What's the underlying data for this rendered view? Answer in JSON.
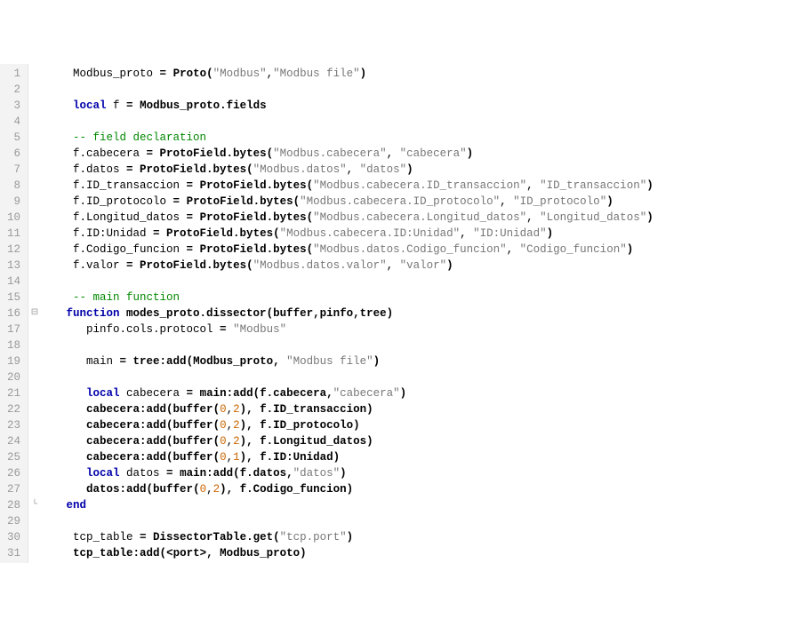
{
  "fold_marks": {
    "16": "⊟",
    "28": "└"
  },
  "lines": [
    {
      "n": 1,
      "tokens": [
        {
          "t": "    ",
          "c": ""
        },
        {
          "t": "Modbus_proto ",
          "c": "tok-id"
        },
        {
          "t": "= ",
          "c": "tok-op tok-bold"
        },
        {
          "t": "Proto",
          "c": "tok-id tok-bold"
        },
        {
          "t": "(",
          "c": "tok-punc tok-bold"
        },
        {
          "t": "\"Modbus\"",
          "c": "tok-str"
        },
        {
          "t": ",",
          "c": "tok-punc"
        },
        {
          "t": "\"Modbus file\"",
          "c": "tok-str"
        },
        {
          "t": ")",
          "c": "tok-punc tok-bold"
        }
      ]
    },
    {
      "n": 2,
      "tokens": []
    },
    {
      "n": 3,
      "tokens": [
        {
          "t": "    ",
          "c": ""
        },
        {
          "t": "local",
          "c": "tok-kw"
        },
        {
          "t": " f ",
          "c": "tok-id"
        },
        {
          "t": "= ",
          "c": "tok-op tok-bold"
        },
        {
          "t": "Modbus_proto.fields",
          "c": "tok-id tok-bold"
        }
      ]
    },
    {
      "n": 4,
      "tokens": []
    },
    {
      "n": 5,
      "tokens": [
        {
          "t": "    ",
          "c": ""
        },
        {
          "t": "-- field declaration",
          "c": "tok-cmt"
        }
      ]
    },
    {
      "n": 6,
      "tokens": [
        {
          "t": "    ",
          "c": ""
        },
        {
          "t": "f.cabecera ",
          "c": "tok-id"
        },
        {
          "t": "= ",
          "c": "tok-op tok-bold"
        },
        {
          "t": "ProtoField.bytes",
          "c": "tok-id tok-bold"
        },
        {
          "t": "(",
          "c": "tok-punc tok-bold"
        },
        {
          "t": "\"Modbus.cabecera\"",
          "c": "tok-str"
        },
        {
          "t": ", ",
          "c": "tok-punc"
        },
        {
          "t": "\"cabecera\"",
          "c": "tok-str"
        },
        {
          "t": ")",
          "c": "tok-punc tok-bold"
        }
      ]
    },
    {
      "n": 7,
      "tokens": [
        {
          "t": "    ",
          "c": ""
        },
        {
          "t": "f.datos ",
          "c": "tok-id"
        },
        {
          "t": "= ",
          "c": "tok-op tok-bold"
        },
        {
          "t": "ProtoField.bytes",
          "c": "tok-id tok-bold"
        },
        {
          "t": "(",
          "c": "tok-punc tok-bold"
        },
        {
          "t": "\"Modbus.datos\"",
          "c": "tok-str"
        },
        {
          "t": ", ",
          "c": "tok-punc"
        },
        {
          "t": "\"datos\"",
          "c": "tok-str"
        },
        {
          "t": ")",
          "c": "tok-punc tok-bold"
        }
      ]
    },
    {
      "n": 8,
      "tokens": [
        {
          "t": "    ",
          "c": ""
        },
        {
          "t": "f.ID_transaccion ",
          "c": "tok-id"
        },
        {
          "t": "= ",
          "c": "tok-op tok-bold"
        },
        {
          "t": "ProtoField.bytes",
          "c": "tok-id tok-bold"
        },
        {
          "t": "(",
          "c": "tok-punc tok-bold"
        },
        {
          "t": "\"Modbus.cabecera.ID_transaccion\"",
          "c": "tok-str"
        },
        {
          "t": ", ",
          "c": "tok-punc"
        },
        {
          "t": "\"ID_transaccion\"",
          "c": "tok-str"
        },
        {
          "t": ")",
          "c": "tok-punc tok-bold"
        }
      ]
    },
    {
      "n": 9,
      "tokens": [
        {
          "t": "    ",
          "c": ""
        },
        {
          "t": "f.ID_protocolo ",
          "c": "tok-id"
        },
        {
          "t": "= ",
          "c": "tok-op tok-bold"
        },
        {
          "t": "ProtoField.bytes",
          "c": "tok-id tok-bold"
        },
        {
          "t": "(",
          "c": "tok-punc tok-bold"
        },
        {
          "t": "\"Modbus.cabecera.ID_protocolo\"",
          "c": "tok-str"
        },
        {
          "t": ", ",
          "c": "tok-punc"
        },
        {
          "t": "\"ID_protocolo\"",
          "c": "tok-str"
        },
        {
          "t": ")",
          "c": "tok-punc tok-bold"
        }
      ]
    },
    {
      "n": 10,
      "tokens": [
        {
          "t": "    ",
          "c": ""
        },
        {
          "t": "f.Longitud_datos ",
          "c": "tok-id"
        },
        {
          "t": "= ",
          "c": "tok-op tok-bold"
        },
        {
          "t": "ProtoField.bytes",
          "c": "tok-id tok-bold"
        },
        {
          "t": "(",
          "c": "tok-punc tok-bold"
        },
        {
          "t": "\"Modbus.cabecera.Longitud_datos\"",
          "c": "tok-str"
        },
        {
          "t": ", ",
          "c": "tok-punc"
        },
        {
          "t": "\"Longitud_datos\"",
          "c": "tok-str"
        },
        {
          "t": ")",
          "c": "tok-punc tok-bold"
        }
      ]
    },
    {
      "n": 11,
      "tokens": [
        {
          "t": "    ",
          "c": ""
        },
        {
          "t": "f.ID:Unidad ",
          "c": "tok-id"
        },
        {
          "t": "= ",
          "c": "tok-op tok-bold"
        },
        {
          "t": "ProtoField.bytes",
          "c": "tok-id tok-bold"
        },
        {
          "t": "(",
          "c": "tok-punc tok-bold"
        },
        {
          "t": "\"Modbus.cabecera.ID:Unidad\"",
          "c": "tok-str"
        },
        {
          "t": ", ",
          "c": "tok-punc"
        },
        {
          "t": "\"ID:Unidad\"",
          "c": "tok-str"
        },
        {
          "t": ")",
          "c": "tok-punc tok-bold"
        }
      ]
    },
    {
      "n": 12,
      "tokens": [
        {
          "t": "    ",
          "c": ""
        },
        {
          "t": "f.Codigo_funcion ",
          "c": "tok-id"
        },
        {
          "t": "= ",
          "c": "tok-op tok-bold"
        },
        {
          "t": "ProtoField.bytes",
          "c": "tok-id tok-bold"
        },
        {
          "t": "(",
          "c": "tok-punc tok-bold"
        },
        {
          "t": "\"Modbus.datos.Codigo_funcion\"",
          "c": "tok-str"
        },
        {
          "t": ", ",
          "c": "tok-punc"
        },
        {
          "t": "\"Codigo_funcion\"",
          "c": "tok-str"
        },
        {
          "t": ")",
          "c": "tok-punc tok-bold"
        }
      ]
    },
    {
      "n": 13,
      "tokens": [
        {
          "t": "    ",
          "c": ""
        },
        {
          "t": "f.valor ",
          "c": "tok-id"
        },
        {
          "t": "= ",
          "c": "tok-op tok-bold"
        },
        {
          "t": "ProtoField.bytes",
          "c": "tok-id tok-bold"
        },
        {
          "t": "(",
          "c": "tok-punc tok-bold"
        },
        {
          "t": "\"Modbus.datos.valor\"",
          "c": "tok-str"
        },
        {
          "t": ", ",
          "c": "tok-punc"
        },
        {
          "t": "\"valor\"",
          "c": "tok-str"
        },
        {
          "t": ")",
          "c": "tok-punc tok-bold"
        }
      ]
    },
    {
      "n": 14,
      "tokens": []
    },
    {
      "n": 15,
      "tokens": [
        {
          "t": "    ",
          "c": ""
        },
        {
          "t": "-- main function",
          "c": "tok-cmt"
        }
      ]
    },
    {
      "n": 16,
      "tokens": [
        {
          "t": "   ",
          "c": ""
        },
        {
          "t": "function",
          "c": "tok-kw"
        },
        {
          "t": " modes_proto.dissector",
          "c": "tok-id tok-bold"
        },
        {
          "t": "(",
          "c": "tok-punc tok-bold"
        },
        {
          "t": "buffer,pinfo,tree",
          "c": "tok-id tok-bold"
        },
        {
          "t": ")",
          "c": "tok-punc tok-bold"
        }
      ]
    },
    {
      "n": 17,
      "tokens": [
        {
          "t": "      ",
          "c": ""
        },
        {
          "t": "pinfo.cols.protocol ",
          "c": "tok-id"
        },
        {
          "t": "= ",
          "c": "tok-op tok-bold"
        },
        {
          "t": "\"Modbus\"",
          "c": "tok-str"
        }
      ]
    },
    {
      "n": 18,
      "tokens": []
    },
    {
      "n": 19,
      "tokens": [
        {
          "t": "      ",
          "c": ""
        },
        {
          "t": "main ",
          "c": "tok-id"
        },
        {
          "t": "= ",
          "c": "tok-op tok-bold"
        },
        {
          "t": "tree:add",
          "c": "tok-id tok-bold"
        },
        {
          "t": "(",
          "c": "tok-punc tok-bold"
        },
        {
          "t": "Modbus_proto, ",
          "c": "tok-id tok-bold"
        },
        {
          "t": "\"Modbus file\"",
          "c": "tok-str"
        },
        {
          "t": ")",
          "c": "tok-punc tok-bold"
        }
      ]
    },
    {
      "n": 20,
      "tokens": []
    },
    {
      "n": 21,
      "tokens": [
        {
          "t": "      ",
          "c": ""
        },
        {
          "t": "local",
          "c": "tok-kw"
        },
        {
          "t": " cabecera ",
          "c": "tok-id"
        },
        {
          "t": "= ",
          "c": "tok-op tok-bold"
        },
        {
          "t": "main:add",
          "c": "tok-id tok-bold"
        },
        {
          "t": "(",
          "c": "tok-punc tok-bold"
        },
        {
          "t": "f.cabecera,",
          "c": "tok-id tok-bold"
        },
        {
          "t": "\"cabecera\"",
          "c": "tok-str"
        },
        {
          "t": ")",
          "c": "tok-punc tok-bold"
        }
      ]
    },
    {
      "n": 22,
      "tokens": [
        {
          "t": "      ",
          "c": ""
        },
        {
          "t": "cabecera:add",
          "c": "tok-id tok-bold"
        },
        {
          "t": "(",
          "c": "tok-punc tok-bold"
        },
        {
          "t": "buffer",
          "c": "tok-id tok-bold"
        },
        {
          "t": "(",
          "c": "tok-punc tok-bold"
        },
        {
          "t": "0",
          "c": "tok-num"
        },
        {
          "t": ",",
          "c": "tok-punc"
        },
        {
          "t": "2",
          "c": "tok-num"
        },
        {
          "t": ")",
          "c": "tok-punc tok-bold"
        },
        {
          "t": ", f.ID_transaccion",
          "c": "tok-id tok-bold"
        },
        {
          "t": ")",
          "c": "tok-punc tok-bold"
        }
      ]
    },
    {
      "n": 23,
      "tokens": [
        {
          "t": "      ",
          "c": ""
        },
        {
          "t": "cabecera:add",
          "c": "tok-id tok-bold"
        },
        {
          "t": "(",
          "c": "tok-punc tok-bold"
        },
        {
          "t": "buffer",
          "c": "tok-id tok-bold"
        },
        {
          "t": "(",
          "c": "tok-punc tok-bold"
        },
        {
          "t": "0",
          "c": "tok-num"
        },
        {
          "t": ",",
          "c": "tok-punc"
        },
        {
          "t": "2",
          "c": "tok-num"
        },
        {
          "t": ")",
          "c": "tok-punc tok-bold"
        },
        {
          "t": ", f.ID_protocolo",
          "c": "tok-id tok-bold"
        },
        {
          "t": ")",
          "c": "tok-punc tok-bold"
        }
      ]
    },
    {
      "n": 24,
      "tokens": [
        {
          "t": "      ",
          "c": ""
        },
        {
          "t": "cabecera:add",
          "c": "tok-id tok-bold"
        },
        {
          "t": "(",
          "c": "tok-punc tok-bold"
        },
        {
          "t": "buffer",
          "c": "tok-id tok-bold"
        },
        {
          "t": "(",
          "c": "tok-punc tok-bold"
        },
        {
          "t": "0",
          "c": "tok-num"
        },
        {
          "t": ",",
          "c": "tok-punc"
        },
        {
          "t": "2",
          "c": "tok-num"
        },
        {
          "t": ")",
          "c": "tok-punc tok-bold"
        },
        {
          "t": ", f.Longitud_datos",
          "c": "tok-id tok-bold"
        },
        {
          "t": ")",
          "c": "tok-punc tok-bold"
        }
      ]
    },
    {
      "n": 25,
      "tokens": [
        {
          "t": "      ",
          "c": ""
        },
        {
          "t": "cabecera:add",
          "c": "tok-id tok-bold"
        },
        {
          "t": "(",
          "c": "tok-punc tok-bold"
        },
        {
          "t": "buffer",
          "c": "tok-id tok-bold"
        },
        {
          "t": "(",
          "c": "tok-punc tok-bold"
        },
        {
          "t": "0",
          "c": "tok-num"
        },
        {
          "t": ",",
          "c": "tok-punc"
        },
        {
          "t": "1",
          "c": "tok-num"
        },
        {
          "t": ")",
          "c": "tok-punc tok-bold"
        },
        {
          "t": ", f.ID:Unidad",
          "c": "tok-id tok-bold"
        },
        {
          "t": ")",
          "c": "tok-punc tok-bold"
        }
      ]
    },
    {
      "n": 26,
      "tokens": [
        {
          "t": "      ",
          "c": ""
        },
        {
          "t": "local",
          "c": "tok-kw"
        },
        {
          "t": " datos ",
          "c": "tok-id"
        },
        {
          "t": "= ",
          "c": "tok-op tok-bold"
        },
        {
          "t": "main:add",
          "c": "tok-id tok-bold"
        },
        {
          "t": "(",
          "c": "tok-punc tok-bold"
        },
        {
          "t": "f.datos,",
          "c": "tok-id tok-bold"
        },
        {
          "t": "\"datos\"",
          "c": "tok-str"
        },
        {
          "t": ")",
          "c": "tok-punc tok-bold"
        }
      ]
    },
    {
      "n": 27,
      "tokens": [
        {
          "t": "      ",
          "c": ""
        },
        {
          "t": "datos:add",
          "c": "tok-id tok-bold"
        },
        {
          "t": "(",
          "c": "tok-punc tok-bold"
        },
        {
          "t": "buffer",
          "c": "tok-id tok-bold"
        },
        {
          "t": "(",
          "c": "tok-punc tok-bold"
        },
        {
          "t": "0",
          "c": "tok-num"
        },
        {
          "t": ",",
          "c": "tok-punc"
        },
        {
          "t": "2",
          "c": "tok-num"
        },
        {
          "t": ")",
          "c": "tok-punc tok-bold"
        },
        {
          "t": ", f.Codigo_funcion",
          "c": "tok-id tok-bold"
        },
        {
          "t": ")",
          "c": "tok-punc tok-bold"
        }
      ]
    },
    {
      "n": 28,
      "tokens": [
        {
          "t": "   ",
          "c": ""
        },
        {
          "t": "end",
          "c": "tok-kw"
        }
      ]
    },
    {
      "n": 29,
      "tokens": []
    },
    {
      "n": 30,
      "tokens": [
        {
          "t": "    ",
          "c": ""
        },
        {
          "t": "tcp_table ",
          "c": "tok-id"
        },
        {
          "t": "= ",
          "c": "tok-op tok-bold"
        },
        {
          "t": "DissectorTable.get",
          "c": "tok-id tok-bold"
        },
        {
          "t": "(",
          "c": "tok-punc tok-bold"
        },
        {
          "t": "\"tcp.port\"",
          "c": "tok-str"
        },
        {
          "t": ")",
          "c": "tok-punc tok-bold"
        }
      ]
    },
    {
      "n": 31,
      "tokens": [
        {
          "t": "    ",
          "c": ""
        },
        {
          "t": "tcp_table:add",
          "c": "tok-id tok-bold"
        },
        {
          "t": "(",
          "c": "tok-punc tok-bold"
        },
        {
          "t": "<port>, Modbus_proto",
          "c": "tok-id tok-bold"
        },
        {
          "t": ")",
          "c": "tok-punc tok-bold"
        }
      ]
    }
  ]
}
